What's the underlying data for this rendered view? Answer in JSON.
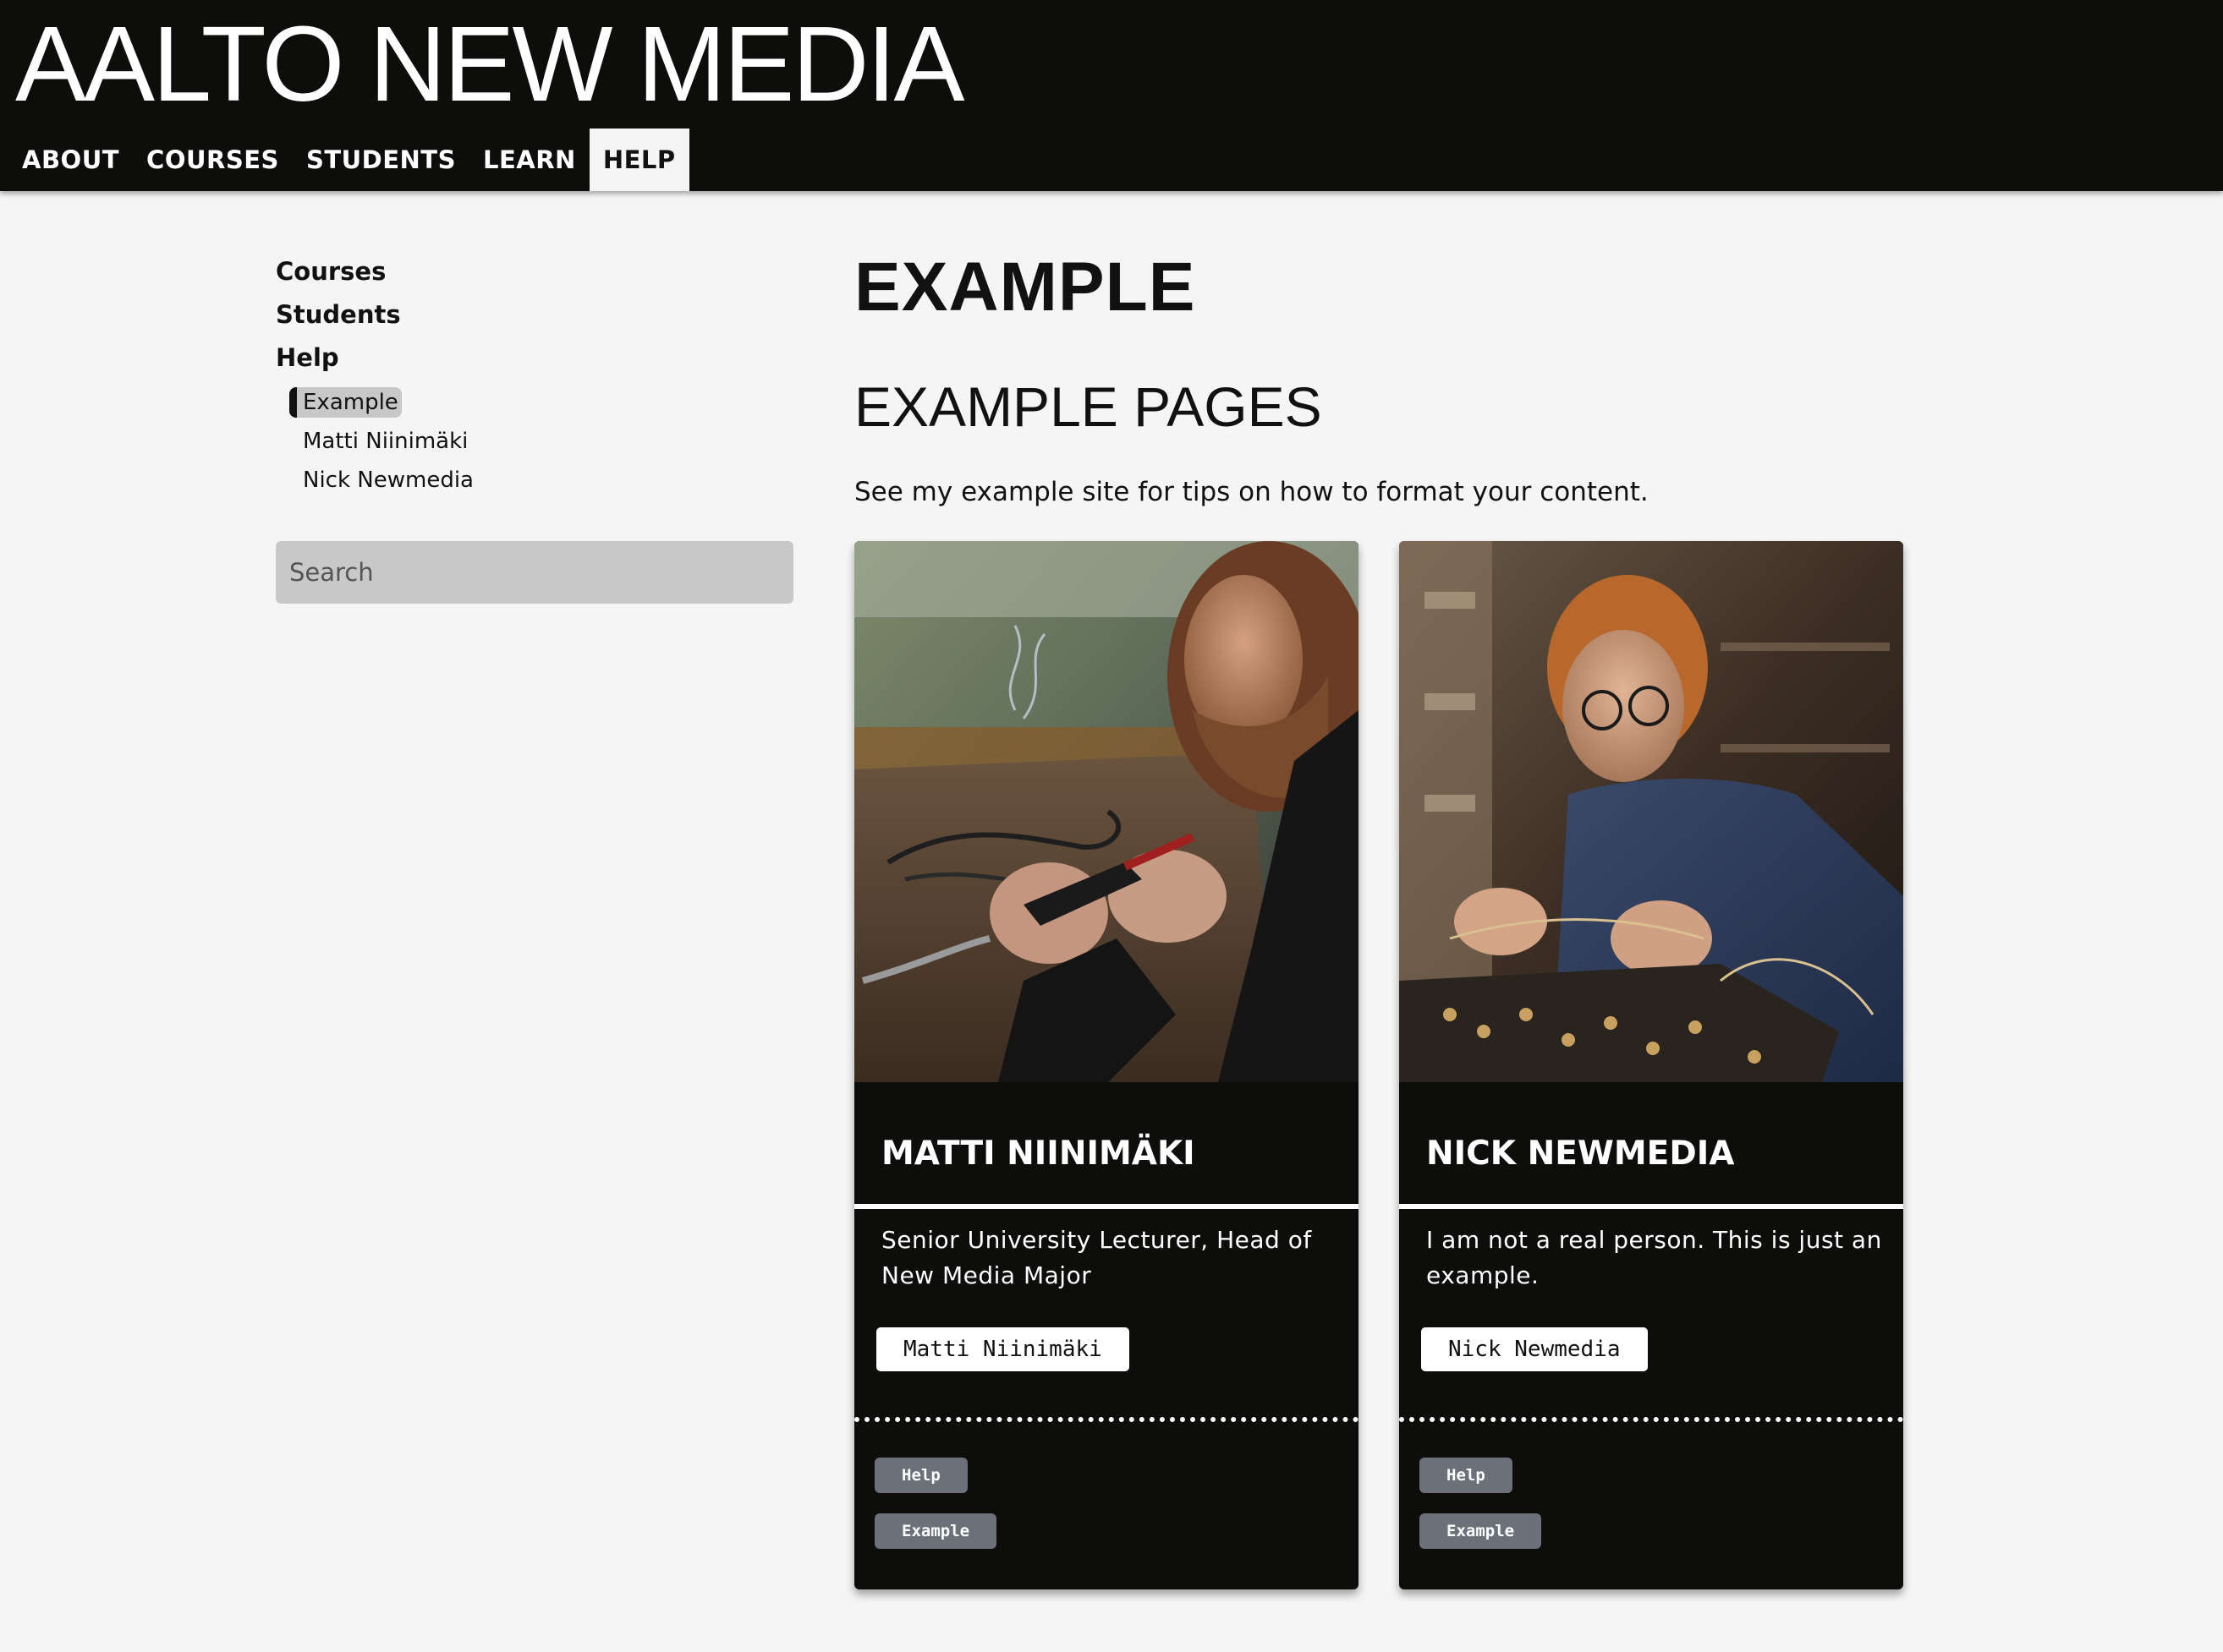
{
  "site": {
    "title": "AALTO NEW MEDIA"
  },
  "nav": {
    "items": [
      {
        "label": "ABOUT",
        "active": false
      },
      {
        "label": "COURSES",
        "active": false
      },
      {
        "label": "STUDENTS",
        "active": false
      },
      {
        "label": "LEARN",
        "active": false
      },
      {
        "label": "HELP",
        "active": true
      }
    ]
  },
  "sidebar": {
    "items": [
      {
        "label": "Courses"
      },
      {
        "label": "Students"
      },
      {
        "label": "Help"
      }
    ],
    "help_children": [
      {
        "label": "Example",
        "active": true
      },
      {
        "label": "Matti Niinimäki",
        "active": false
      },
      {
        "label": "Nick Newmedia",
        "active": false
      }
    ],
    "search": {
      "placeholder": "Search",
      "value": ""
    }
  },
  "main": {
    "title": "EXAMPLE",
    "section_title": "EXAMPLE PAGES",
    "intro": "See my example site for tips on how to format your content.",
    "cards": [
      {
        "name": "MATTI NIINIMÄKI",
        "description": "Senior University Lecturer, Head of New Media Major",
        "link_label": "Matti Niinimäki",
        "image_icon": "soldering-photo-icon",
        "tags": [
          "Help",
          "Example"
        ]
      },
      {
        "name": "NICK NEWMEDIA",
        "description": "I am not a real person. This is just an example.",
        "link_label": "Nick Newmedia",
        "image_icon": "electronics-photo-icon",
        "tags": [
          "Help",
          "Example"
        ]
      }
    ]
  },
  "colors": {
    "header_bg": "#0d0e0b",
    "page_bg": "#f5f5f5",
    "card_bg": "#0d0e0b",
    "tag_bg": "#6c7079",
    "search_bg": "#c8c8c8"
  }
}
